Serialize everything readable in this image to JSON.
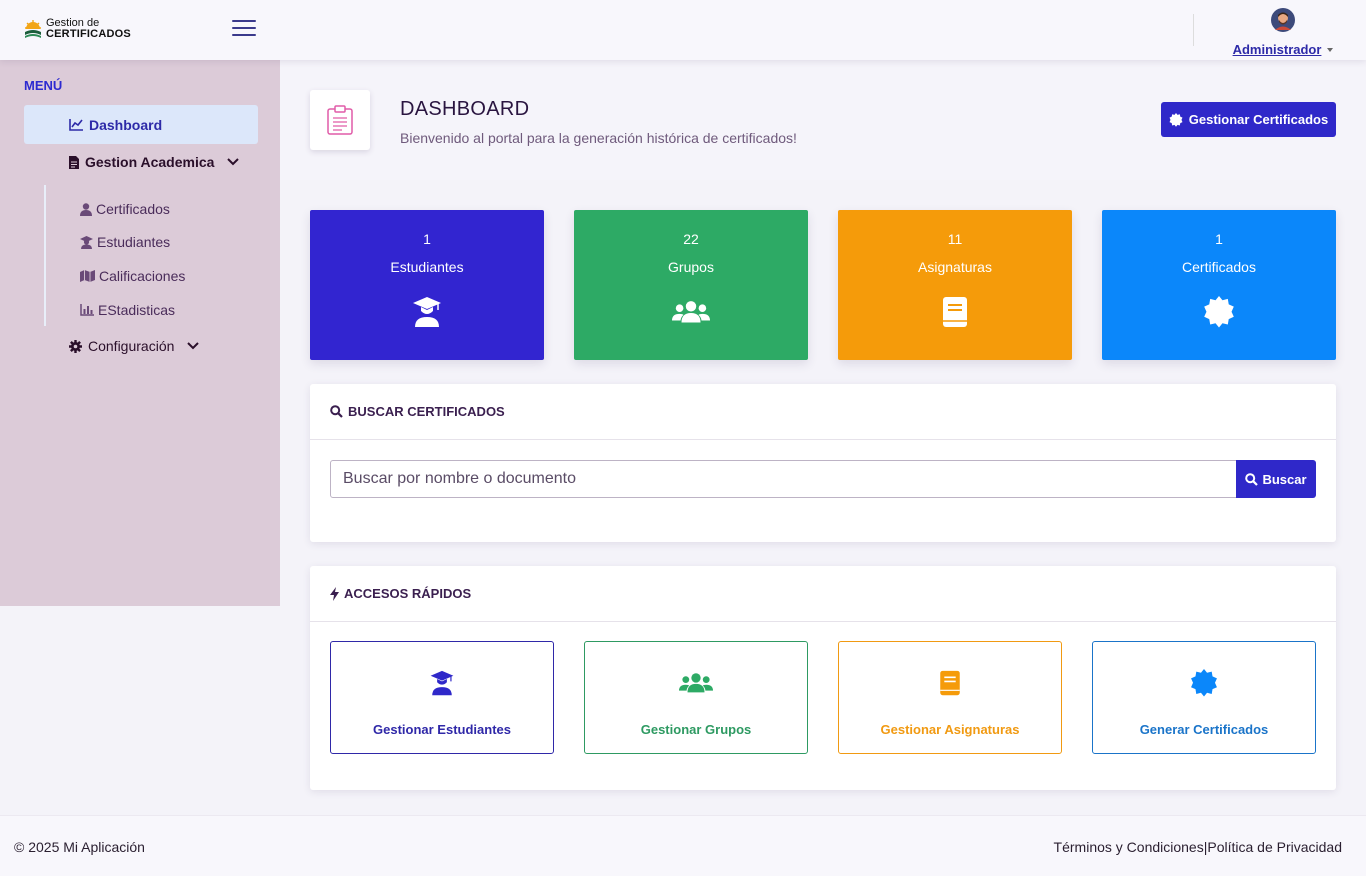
{
  "brand": {
    "line1": "Gestion de",
    "line2": "CERTIFICADOS"
  },
  "user": {
    "name": "Administrador"
  },
  "sidebar": {
    "menu_title": "MENÚ",
    "dashboard": "Dashboard",
    "academic": "Gestion Academica",
    "academic_items": [
      "Certificados",
      "Estudiantes",
      "Calificaciones",
      "EStadisticas"
    ],
    "config": "Configuración"
  },
  "header": {
    "title": "DASHBOARD",
    "subtitle": "Bienvenido al portal para la generación histórica de certificados!",
    "button": "Gestionar Certificados"
  },
  "stats": [
    {
      "value": "1",
      "label": "Estudiantes",
      "color": "#3225d0",
      "icon": "graduate-icon"
    },
    {
      "value": "22",
      "label": "Grupos",
      "color": "#2daa65",
      "icon": "users-icon"
    },
    {
      "value": "11",
      "label": "Asignaturas",
      "color": "#f59b0a",
      "icon": "book-icon"
    },
    {
      "value": "1",
      "label": "Certificados",
      "color": "#0b87fa",
      "icon": "certificate-icon"
    }
  ],
  "search": {
    "title": "BUSCAR CERTIFICADOS",
    "placeholder": "Buscar por nombre o documento",
    "button": "Buscar"
  },
  "quick": {
    "title": "ACCESOS RÁPIDOS",
    "items": [
      {
        "label": "Gestionar Estudiantes",
        "color": "#2f28a8",
        "icon": "graduate-icon"
      },
      {
        "label": "Gestionar Grupos",
        "color": "#2e9a62",
        "icon": "users-icon"
      },
      {
        "label": "Gestionar Asignaturas",
        "color": "#f19a12",
        "icon": "book-icon"
      },
      {
        "label": "Generar Certificados",
        "color": "#1a74c9",
        "icon": "certificate-icon"
      }
    ]
  },
  "footer": {
    "copyright": "© 2025 Mi Aplicación",
    "terms": "Términos y Condiciones",
    "separator": "|",
    "privacy": "Política de Privacidad"
  }
}
